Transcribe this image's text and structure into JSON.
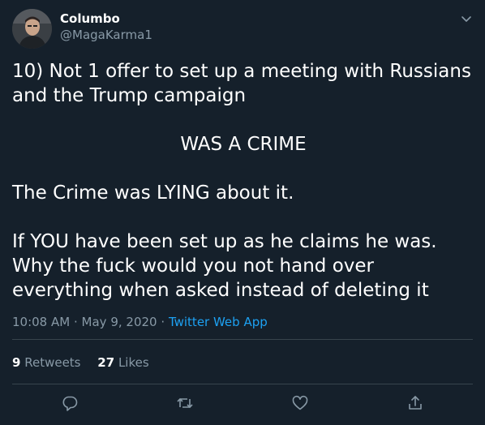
{
  "author": {
    "display_name": "Columbo",
    "handle": "@MagaKarma1"
  },
  "tweet": {
    "lines": [
      "10) Not 1 offer to set up a meeting with Russians and the Trump campaign",
      "WAS A CRIME",
      "The Crime was LYING about it.",
      "If YOU have been set up as he claims he was. Why the fuck would you not hand over everything when asked instead of deleting it"
    ],
    "time": "10:08 AM",
    "separator": "·",
    "date": "May 9, 2020",
    "source": "Twitter Web App"
  },
  "stats": {
    "retweets_count": "9",
    "retweets_label": "Retweets",
    "likes_count": "27",
    "likes_label": "Likes"
  },
  "icons": {
    "caret": "chevron-down-icon",
    "reply": "reply-icon",
    "retweet": "retweet-icon",
    "like": "heart-icon",
    "share": "share-icon"
  },
  "colors": {
    "background": "#15202b",
    "text": "#ffffff",
    "secondary": "#8899a6",
    "accent": "#1da1f2",
    "divider": "#38444d"
  }
}
